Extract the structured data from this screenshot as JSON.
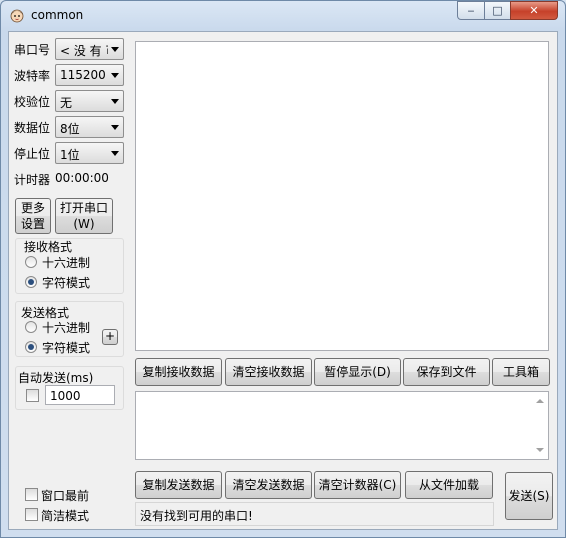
{
  "window": {
    "title": "common",
    "minimize_glyph": "‒",
    "maximize_glyph": "□",
    "close_glyph": "✕"
  },
  "settings": {
    "port_label": "串口号",
    "port_value": "< 没 有 可",
    "baud_label": "波特率",
    "baud_value": "115200",
    "parity_label": "校验位",
    "parity_value": "无",
    "databits_label": "数据位",
    "databits_value": "8位",
    "stopbits_label": "停止位",
    "stopbits_value": "1位",
    "timer_label": "计时器",
    "timer_value": "00:00:00"
  },
  "buttons": {
    "more_settings_line1": "更多",
    "more_settings_line2": "设置",
    "open_port_line1": "打开串口",
    "open_port_line2": "(W)"
  },
  "receive_format": {
    "title": "接收格式",
    "hex_label": "十六进制",
    "char_label": "字符模式",
    "selected": "字符模式"
  },
  "send_format": {
    "title": "发送格式",
    "hex_label": "十六进制",
    "char_label": "字符模式",
    "selected": "字符模式",
    "add_label": "+"
  },
  "auto_send": {
    "title": "自动发送(ms)",
    "interval": "1000",
    "checked": false
  },
  "options": {
    "topmost_label": "窗口最前",
    "simple_label": "简洁模式"
  },
  "receive_toolbar": {
    "copy": "复制接收数据",
    "clear": "清空接收数据",
    "pause": "暂停显示(D)",
    "save": "保存到文件",
    "tools": "工具箱"
  },
  "send_toolbar": {
    "copy": "复制发送数据",
    "clear": "清空发送数据",
    "clear_counter": "清空计数器(C)",
    "load_file": "从文件加载",
    "send": "发送(S)"
  },
  "status": {
    "message": "没有找到可用的串口!"
  },
  "colors": {
    "accent": "#2b4f7e",
    "close_button": "#c6412a"
  }
}
